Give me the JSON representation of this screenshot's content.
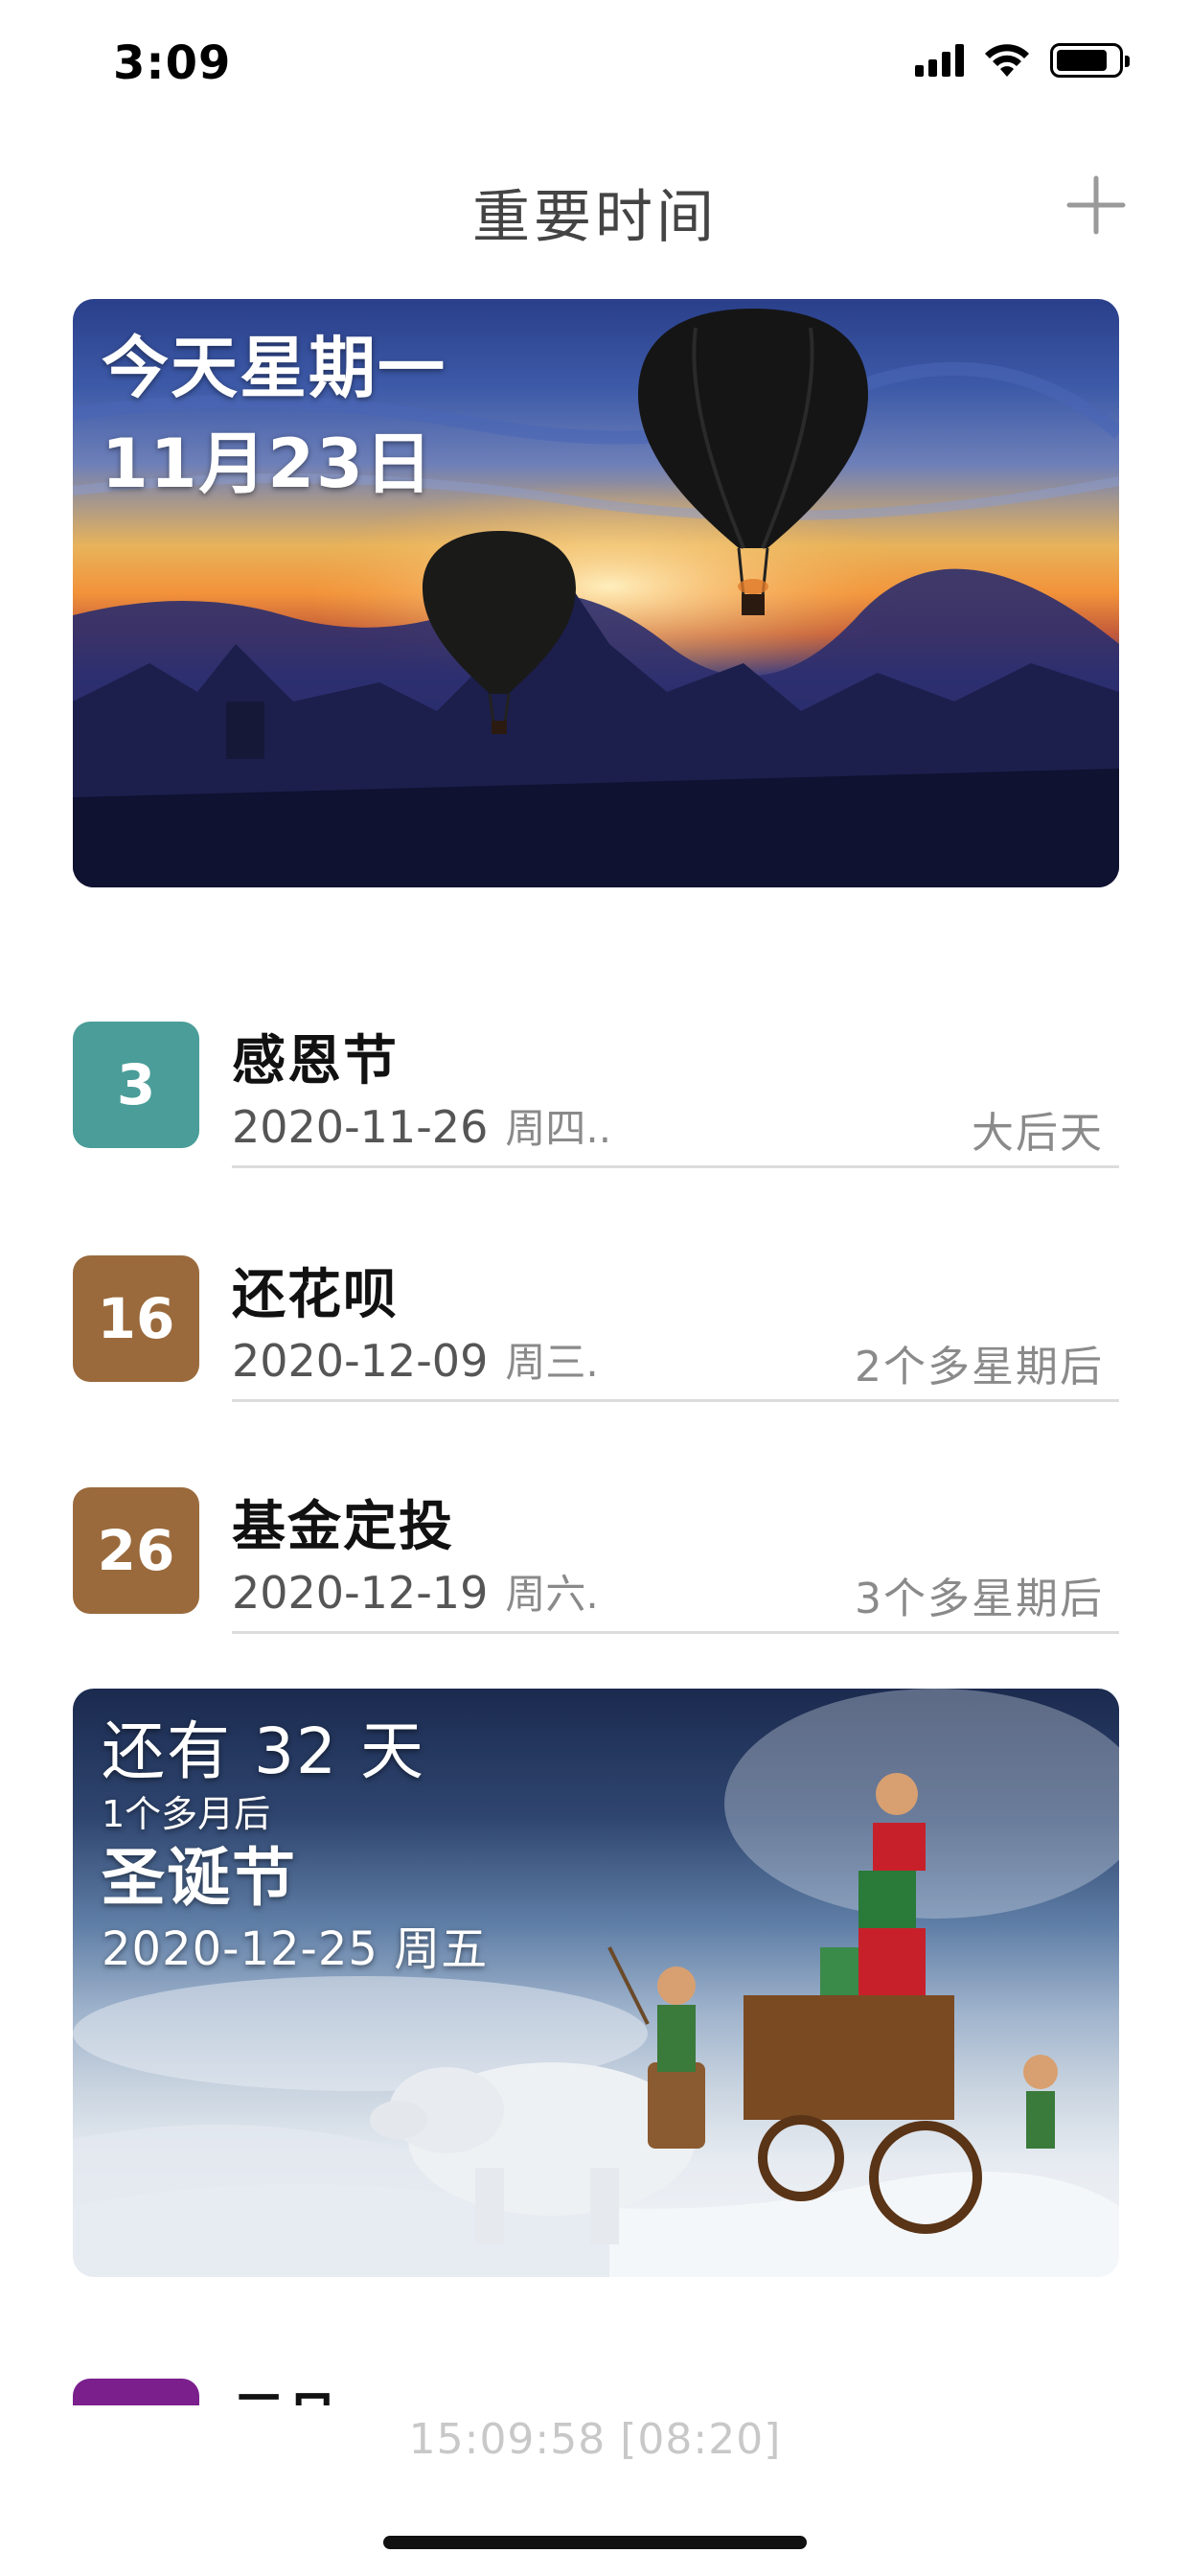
{
  "status_bar": {
    "time": "3:09"
  },
  "nav": {
    "title": "重要时间",
    "add_icon": "plus-icon"
  },
  "today_card": {
    "line1": "今天星期一",
    "line2": "11月23日"
  },
  "events": [
    {
      "days": "3",
      "name": "感恩节",
      "date": "2020-11-26",
      "weekday": "周四..",
      "relative": "大后天",
      "color": "#4a9d98"
    },
    {
      "days": "16",
      "name": "还花呗",
      "date": "2020-12-09",
      "weekday": "周三.",
      "relative": "2个多星期后",
      "color": "#9a6a3c"
    },
    {
      "days": "26",
      "name": "基金定投",
      "date": "2020-12-19",
      "weekday": "周六.",
      "relative": "3个多星期后",
      "color": "#9a6a3c"
    }
  ],
  "featured_event": {
    "countdown": "还有 32 天",
    "approx": "1个多月后",
    "name": "圣诞节",
    "date": "2020-12-25 周五"
  },
  "partial_event": {
    "name": "元旦",
    "color": "#7a1f8c"
  },
  "footer": {
    "clock": "15:09:58 [08:20]"
  }
}
